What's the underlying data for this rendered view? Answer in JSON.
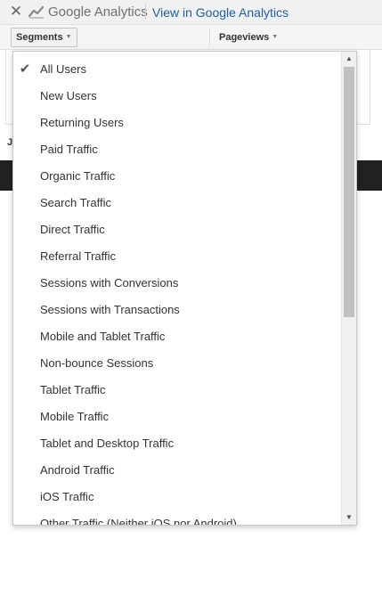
{
  "header": {
    "close_glyph": "✕",
    "brand_text": "Google Analytics",
    "link_text": "View in Google Analytics"
  },
  "toolbar": {
    "segments_label": "Segments",
    "pageviews_label": "Pageviews",
    "caret_glyph": "▼"
  },
  "background": {
    "partial_letter": "J"
  },
  "dropdown": {
    "selected_index": 0,
    "check_glyph": "✔",
    "items": [
      "All Users",
      "New Users",
      "Returning Users",
      "Paid Traffic",
      "Organic Traffic",
      "Search Traffic",
      "Direct Traffic",
      "Referral Traffic",
      "Sessions with Conversions",
      "Sessions with Transactions",
      "Mobile and Tablet Traffic",
      "Non-bounce Sessions",
      "Tablet Traffic",
      "Mobile Traffic",
      "Tablet and Desktop Traffic",
      "Android Traffic",
      "iOS Traffic",
      "Other Traffic (Neither iOS nor Android)"
    ],
    "scroll_up_glyph": "▲",
    "scroll_down_glyph": "▼"
  },
  "colors": {
    "link": "#1a5fa8",
    "dark_bar": "#212121",
    "scroll_thumb": "#c1c1c1"
  },
  "icons": {
    "close": "close-icon",
    "brand": "analytics-chart-icon",
    "check": "check-icon",
    "dropdown_caret": "chevron-down-icon"
  }
}
